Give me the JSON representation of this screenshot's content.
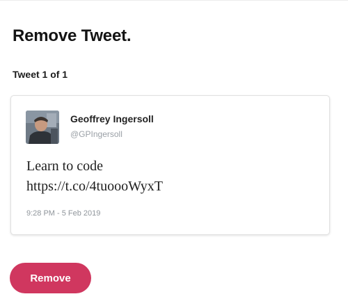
{
  "page": {
    "title": "Remove Tweet.",
    "subtitle": "Tweet 1 of 1"
  },
  "tweet": {
    "author_name": "Geoffrey Ingersoll",
    "author_handle": "@GPIngersoll",
    "text_lines": [
      "Learn to code",
      "https://t.co/4tuoooWyxT"
    ],
    "timestamp": "9:28 PM - 5 Feb 2019",
    "avatar_icon": "user-photo"
  },
  "actions": {
    "remove_label": "Remove"
  },
  "colors": {
    "accent": "#d0375f",
    "handle": "#9aa0a6",
    "card_border": "#e0e0e0"
  }
}
